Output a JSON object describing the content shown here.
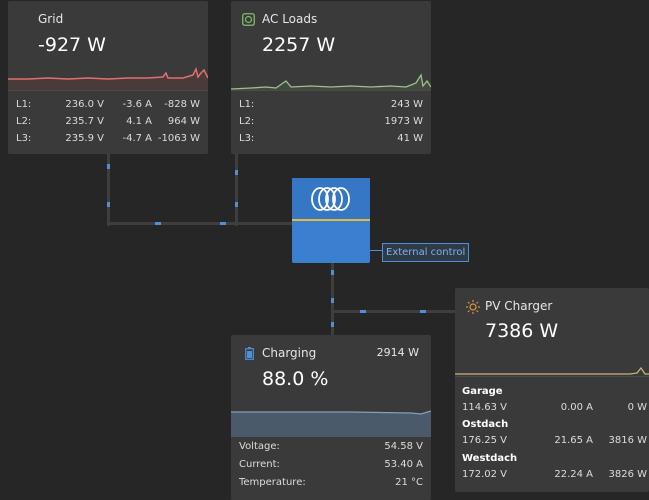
{
  "grid": {
    "title": "Grid",
    "value": "-927 W",
    "rows": [
      {
        "phase": "L1:",
        "voltage": "236.0 V",
        "current": "-3.6 A",
        "power": "-828 W"
      },
      {
        "phase": "L2:",
        "voltage": "235.7 V",
        "current": "4.1 A",
        "power": "964 W"
      },
      {
        "phase": "L3:",
        "voltage": "235.9 V",
        "current": "-4.7 A",
        "power": "-1063 W"
      }
    ],
    "sparkline_color": "#e07070"
  },
  "ac_loads": {
    "title": "AC Loads",
    "value": "2257 W",
    "icon": "ac-loads-icon",
    "rows": [
      {
        "phase": "L1:",
        "power": "243 W"
      },
      {
        "phase": "L2:",
        "power": "1973 W"
      },
      {
        "phase": "L3:",
        "power": "41 W"
      }
    ],
    "sparkline_color": "#9fbf90"
  },
  "inverter": {
    "icon": "victron-logo-icon",
    "external_control_label": "External control"
  },
  "battery": {
    "title": "Charging",
    "power": "2914 W",
    "soc": "88.0 %",
    "icon": "battery-icon",
    "rows": [
      {
        "label": "Voltage:",
        "value": "54.58 V"
      },
      {
        "label": "Current:",
        "value": "53.40 A"
      },
      {
        "label": "Temperature:",
        "value": "21 °C"
      }
    ]
  },
  "pv_charger": {
    "title": "PV Charger",
    "value": "7386 W",
    "icon": "sun-icon",
    "sections": [
      {
        "name": "Garage",
        "voltage": "114.63 V",
        "current": "0.00 A",
        "power": "0 W"
      },
      {
        "name": "Ostdach",
        "voltage": "176.25 V",
        "current": "21.65 A",
        "power": "3816 W"
      },
      {
        "name": "Westdach",
        "voltage": "172.02 V",
        "current": "22.24 A",
        "power": "3826 W"
      }
    ],
    "sparkline_color": "#c9b07a"
  },
  "colors": {
    "background": "#262626",
    "card": "#3a3a3a",
    "accent_blue": "#3a7fd0",
    "flow_blue": "#4f8fd4",
    "inverter_stripe": "#e2b93b"
  }
}
